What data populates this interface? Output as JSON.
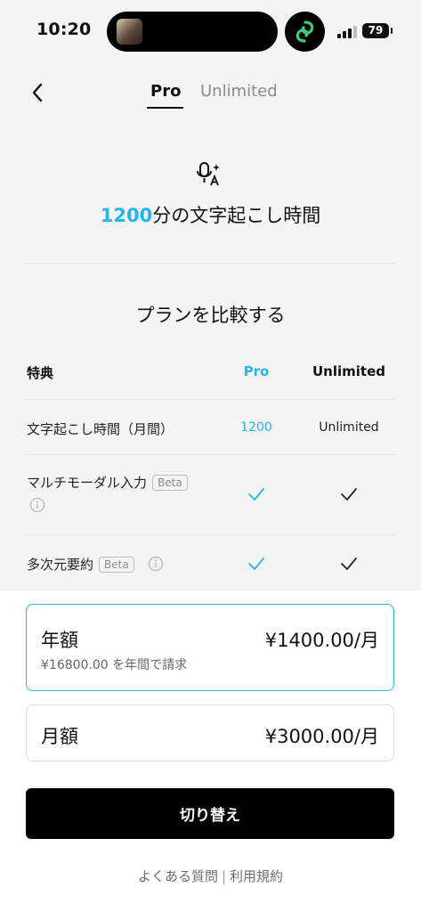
{
  "status_bar": {
    "time": "10:20",
    "battery": "79"
  },
  "nav": {
    "tabs": [
      {
        "label": "Pro",
        "active": true
      },
      {
        "label": "Unlimited",
        "active": false
      }
    ]
  },
  "hero": {
    "minutes": "1200",
    "suffix": "分の文字起こし時間"
  },
  "compare": {
    "title": "プランを比較する",
    "headers": {
      "feature": "特典",
      "pro": "Pro",
      "unlimited": "Unlimited"
    },
    "rows": [
      {
        "label": "文字起こし時間（月間）",
        "pro": "1200",
        "unlimited": "Unlimited"
      },
      {
        "label": "マルチモーダル入力",
        "badge": "Beta",
        "pro": "check",
        "unlimited": "check"
      },
      {
        "label": "多次元要約",
        "badge": "Beta",
        "pro": "check",
        "unlimited": "check"
      }
    ]
  },
  "plans": {
    "annual": {
      "name": "年額",
      "price": "¥1400.00/月",
      "sub": "¥16800.00 を年間で請求",
      "selected": true
    },
    "monthly": {
      "name": "月額",
      "price": "¥3000.00/月",
      "selected": false
    }
  },
  "cta": {
    "label": "切り替え"
  },
  "footer": {
    "faq": "よくある質問",
    "separator": "|",
    "terms": "利用規約"
  },
  "colors": {
    "accent": "#22b7ee",
    "app_logo": "#34d17a",
    "background": "#f4f4f4"
  },
  "icons": [
    "back-chevron-icon",
    "mic-transcribe-icon",
    "info-icon",
    "check-icon",
    "app-logo-icon"
  ]
}
